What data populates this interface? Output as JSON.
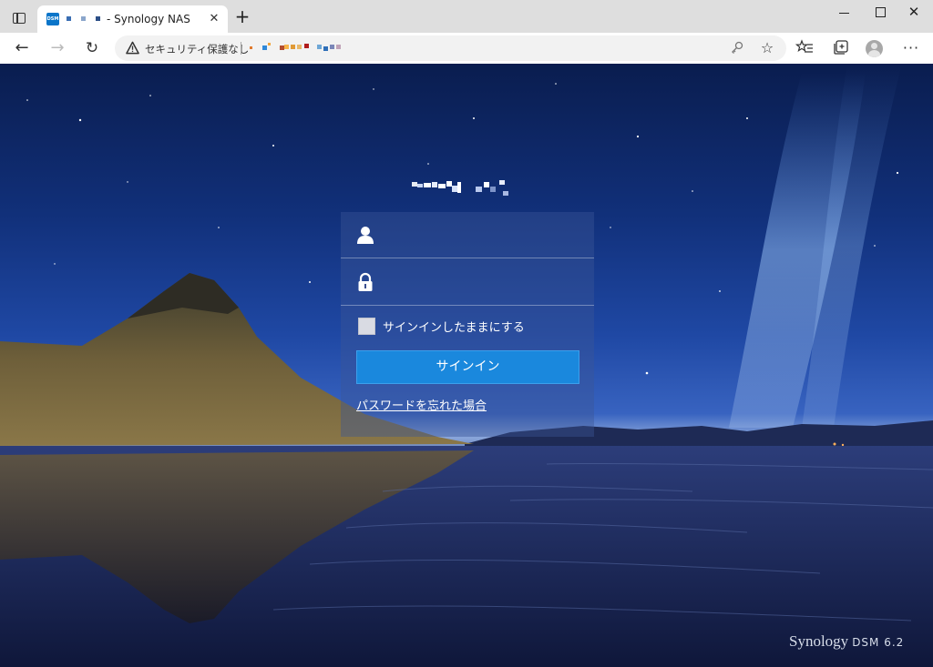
{
  "browser": {
    "tab_title": "- Synology NAS",
    "favicon_text": "DSM",
    "close_tab_glyph": "✕",
    "new_tab_glyph": "+",
    "address": {
      "security_label": "セキュリティ保護なし",
      "separator": "|"
    },
    "icons": {
      "tab_actions": "tab-actions-icon",
      "back": "←",
      "forward": "→",
      "reload": "↻",
      "key": "key-icon",
      "add_favorite": "☆",
      "favorites": "★",
      "collections": "⧉",
      "menu": "···"
    },
    "window_close_glyph": "✕"
  },
  "login": {
    "hostname_logo": "redacted-hostname-logo",
    "username_placeholder": "",
    "password_placeholder": "",
    "remember_label": "サインインしたままにする",
    "remember_checked": false,
    "signin_button": "サインイン",
    "forgot_password": "パスワードを忘れた場合"
  },
  "footer": {
    "brand": "Synology",
    "product": "DSM 6.2"
  }
}
